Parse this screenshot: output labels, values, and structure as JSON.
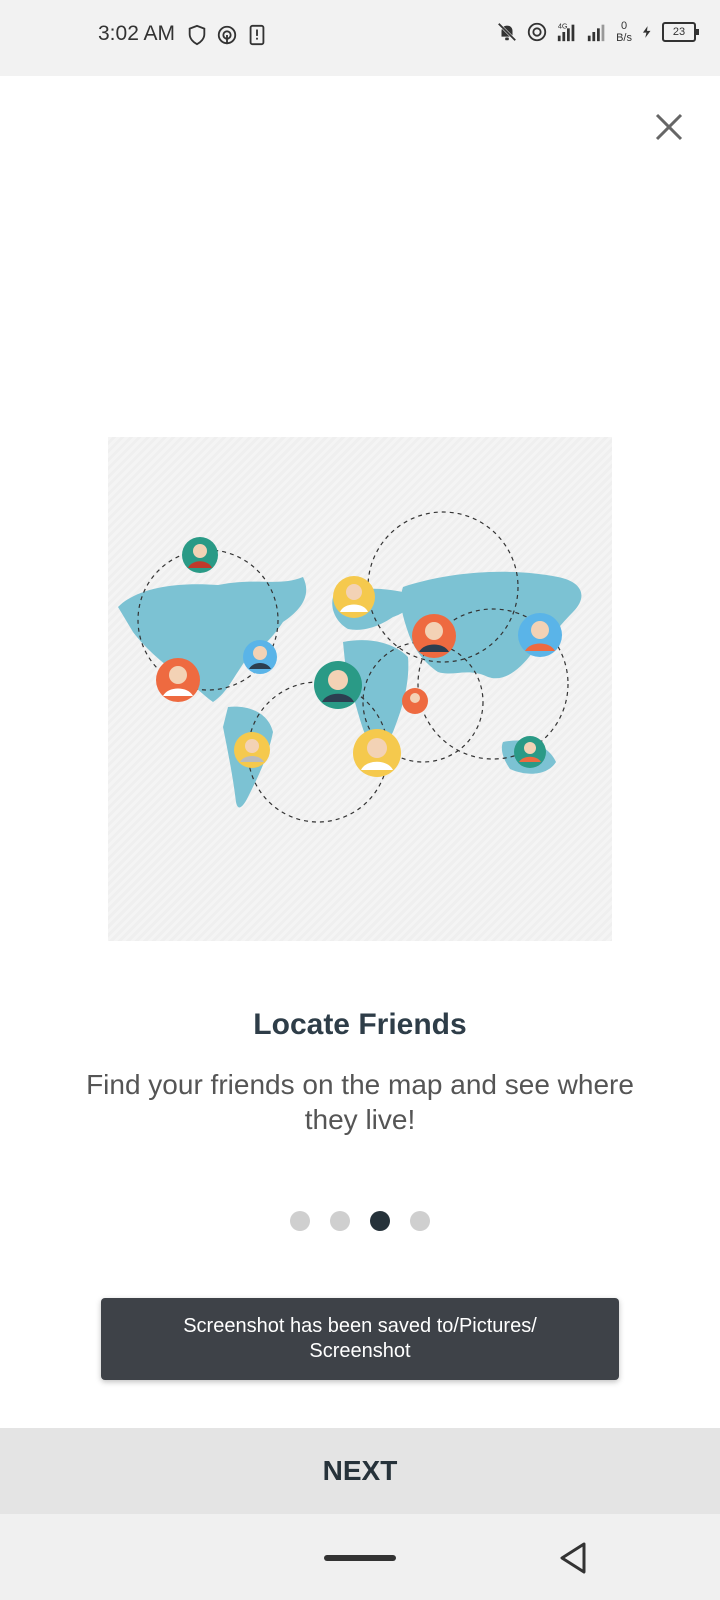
{
  "status_bar": {
    "time": "3:02 AM",
    "left_icons": [
      "shield-icon",
      "hotspot-icon",
      "sim-alert-icon"
    ],
    "right_icons": [
      "bell-off-icon",
      "hotspot-icon",
      "signal-4g-icon",
      "signal-icon"
    ],
    "network_type": "4G",
    "speed_value": "0",
    "speed_unit": "B/s",
    "battery_level": "23"
  },
  "onboarding": {
    "close_icon": "close-icon",
    "illustration": "world-map-with-friends-avatars",
    "title": "Locate Friends",
    "description": "Find your friends on the map and see where they live!",
    "pages_total": 4,
    "current_page": 3
  },
  "toast": {
    "message": "Screenshot has been saved to/Pictures/ Screenshot"
  },
  "footer": {
    "next_label": "NEXT"
  },
  "nav_bar": {
    "home_icon": "home-pill-icon",
    "back_icon": "back-triangle-icon"
  },
  "colors": {
    "map": "#7cc2d3",
    "title": "#2e3d48",
    "toast_bg": "#3e4248",
    "dot_active": "#26323a",
    "dot_inactive": "#cfcfcf"
  }
}
